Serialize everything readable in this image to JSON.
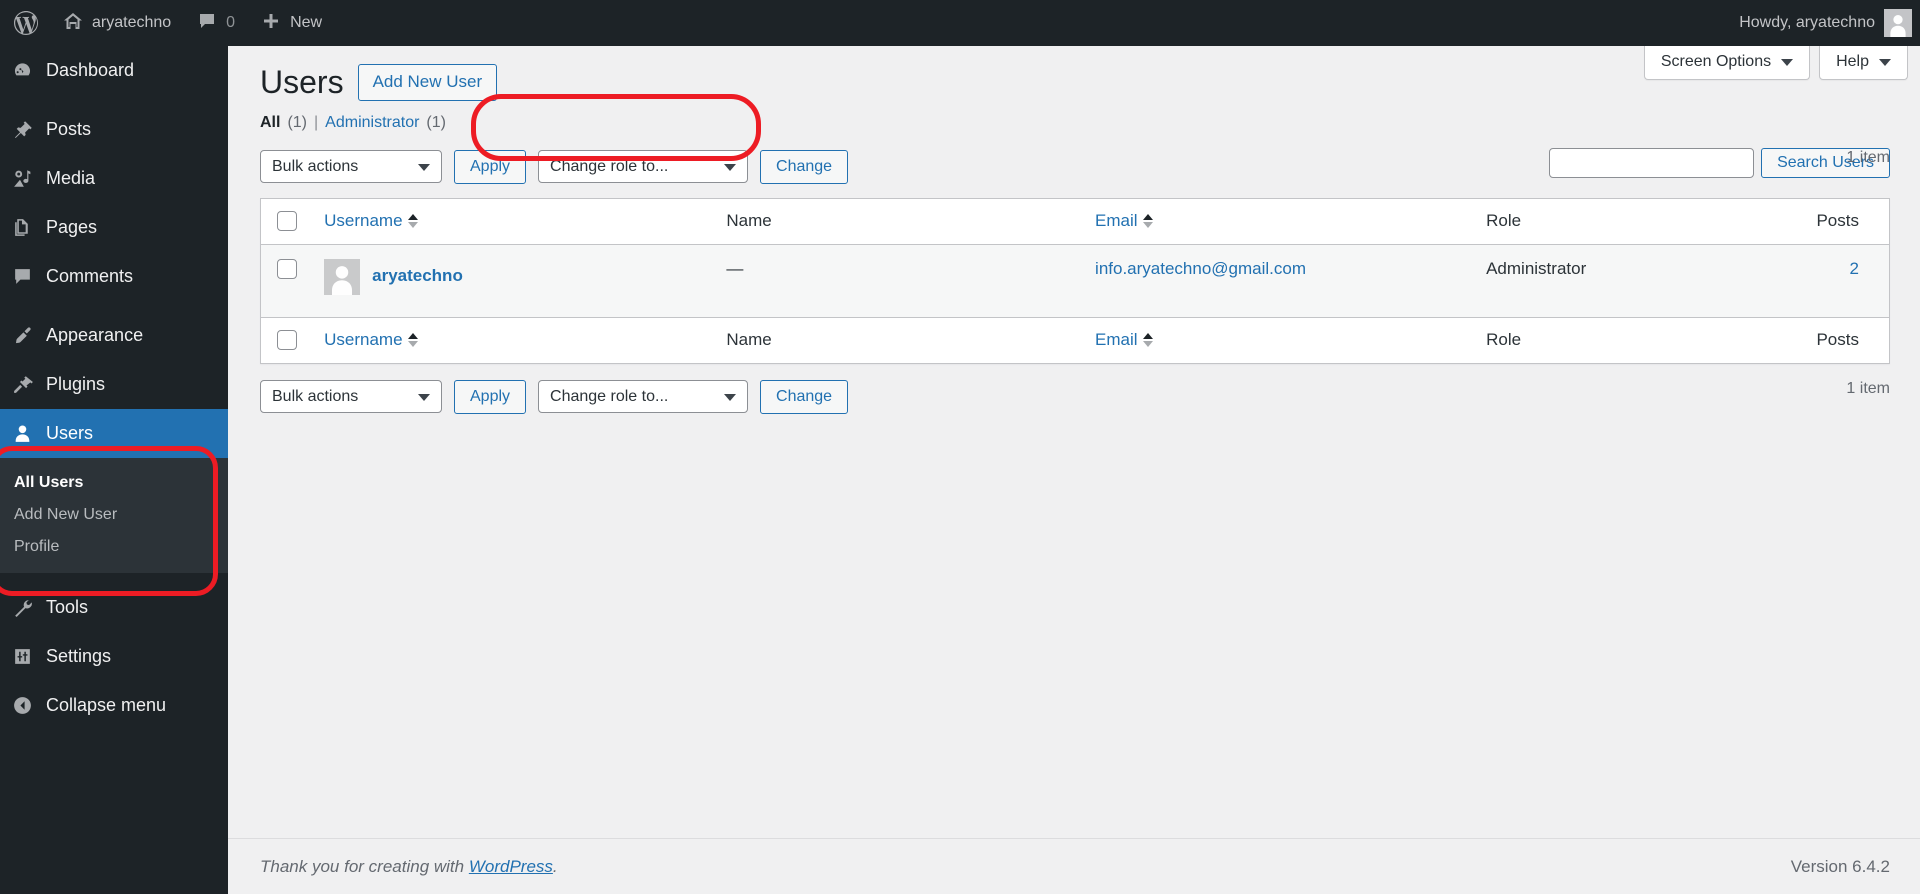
{
  "adminbar": {
    "logo_icon": "wordpress-logo-icon",
    "site_icon": "home-icon",
    "site_name": "aryatechno",
    "comments_icon": "comment-bubble-icon",
    "comments_count": "0",
    "new_icon": "plus-icon",
    "new_label": "New",
    "howdy": "Howdy, aryatechno",
    "avatar_icon": "user-avatar-icon"
  },
  "sidebar": {
    "items": [
      {
        "label": "Dashboard",
        "icon": "dashboard-icon",
        "key": "dashboard"
      },
      {
        "label": "Posts",
        "icon": "pin-icon",
        "key": "posts"
      },
      {
        "label": "Media",
        "icon": "media-camera-icon",
        "key": "media"
      },
      {
        "label": "Pages",
        "icon": "pages-icon",
        "key": "pages"
      },
      {
        "label": "Comments",
        "icon": "comment-bubble-icon",
        "key": "comments"
      },
      {
        "label": "Appearance",
        "icon": "paintbrush-icon",
        "key": "appearance"
      },
      {
        "label": "Plugins",
        "icon": "plug-icon",
        "key": "plugins"
      },
      {
        "label": "Users",
        "icon": "user-icon",
        "key": "users"
      },
      {
        "label": "Tools",
        "icon": "wrench-icon",
        "key": "tools"
      },
      {
        "label": "Settings",
        "icon": "settings-sliders-icon",
        "key": "settings"
      },
      {
        "label": "Collapse menu",
        "icon": "collapse-arrow-icon",
        "key": "collapse"
      }
    ],
    "submenu": [
      {
        "label": "All Users",
        "current": true
      },
      {
        "label": "Add New User",
        "current": false
      },
      {
        "label": "Profile",
        "current": false
      }
    ]
  },
  "screen_meta": {
    "screen_options_label": "Screen Options",
    "help_label": "Help",
    "caret_icon": "chevron-down-icon"
  },
  "page": {
    "title": "Users",
    "add_new_label": "Add New User"
  },
  "views": {
    "all_label": "All",
    "all_count": "(1)",
    "divider": "|",
    "administrator_label": "Administrator",
    "administrator_count": "(1)"
  },
  "search": {
    "value": "",
    "placeholder": "",
    "button_label": "Search Users"
  },
  "tablenav_top": {
    "bulk_actions_label": "Bulk actions",
    "apply_label": "Apply",
    "change_role_label": "Change role to...",
    "change_label": "Change",
    "displaying_num": "1 item"
  },
  "tablenav_bottom": {
    "bulk_actions_label": "Bulk actions",
    "apply_label": "Apply",
    "change_role_label": "Change role to...",
    "change_label": "Change",
    "displaying_num": "1 item"
  },
  "table": {
    "columns": {
      "username": "Username",
      "name": "Name",
      "email": "Email",
      "role": "Role",
      "posts": "Posts"
    },
    "rows": [
      {
        "username": "aryatechno",
        "name": "—",
        "email": "info.aryatechno@gmail.com",
        "role": "Administrator",
        "posts": "2",
        "avatar_icon": "user-avatar-icon"
      }
    ]
  },
  "footer": {
    "thanks_prefix": "Thank you for creating with ",
    "wordpress_link": "WordPress",
    "thanks_suffix": ".",
    "version": "Version 6.4.2"
  },
  "colors": {
    "admin_dark": "#1d2327",
    "submenu_dark": "#2c3338",
    "accent_blue": "#2271b1",
    "link_blue": "#2271b1",
    "annotation_red": "#ed1c24",
    "page_bg": "#f0f0f1"
  }
}
